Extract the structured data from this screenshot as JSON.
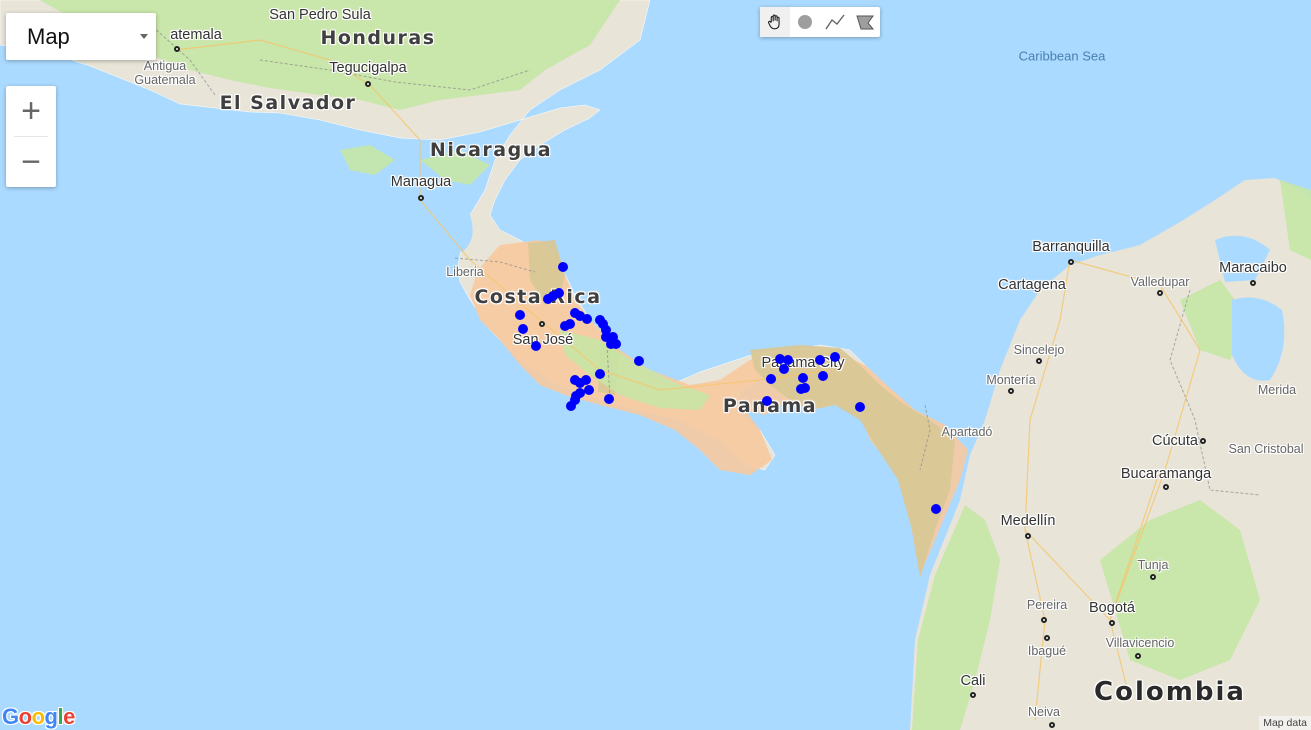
{
  "controls": {
    "map_type_label": "Map",
    "zoom_in_label": "+",
    "zoom_out_label": "−",
    "attribution": "Map data"
  },
  "draw_tools": [
    {
      "name": "hand-icon",
      "active": true
    },
    {
      "name": "circle-icon",
      "active": false
    },
    {
      "name": "polyline-icon",
      "active": false
    },
    {
      "name": "polygon-icon",
      "active": false
    }
  ],
  "logo": {
    "text": "Google",
    "colors": [
      "#4285F4",
      "#EA4335",
      "#FBBC05",
      "#4285F4",
      "#34A853",
      "#EA4335"
    ]
  },
  "colors": {
    "water": "#aadaff",
    "land": "#e8e4d8",
    "green": "#c5e6a6",
    "highlight_orange": "#f7c9a0",
    "highlight_olive": "#d9c796",
    "marker": "#0000ff"
  },
  "labels": {
    "country": [
      {
        "id": "honduras",
        "text": "Honduras"
      },
      {
        "id": "el-salvador",
        "text": "El Salvador"
      },
      {
        "id": "nicaragua",
        "text": "Nicaragua"
      },
      {
        "id": "costa-rica",
        "text": "Costa Rica"
      },
      {
        "id": "panama",
        "text": "Panama"
      }
    ],
    "big": [
      {
        "id": "colombia",
        "text": "Colombia"
      }
    ],
    "sea": [
      {
        "id": "caribbean",
        "text": "Caribbean Sea"
      }
    ],
    "city": [
      {
        "id": "san-pedro-sula",
        "text": "San Pedro Sula"
      },
      {
        "id": "guatemala",
        "text": "atemala"
      },
      {
        "id": "tegucigalpa",
        "text": "Tegucigalpa"
      },
      {
        "id": "managua",
        "text": "Managua"
      },
      {
        "id": "san-jose",
        "text": "San José"
      },
      {
        "id": "panama-city",
        "text": "Panama City"
      },
      {
        "id": "barranquilla",
        "text": "Barranquilla"
      },
      {
        "id": "maracaibo",
        "text": "Maracaibo"
      },
      {
        "id": "medellin",
        "text": "Medellín"
      },
      {
        "id": "bogota",
        "text": "Bogotá"
      },
      {
        "id": "cali",
        "text": "Cali"
      },
      {
        "id": "bucaramanga",
        "text": "Bucaramanga"
      },
      {
        "id": "cucuta",
        "text": "Cúcuta"
      },
      {
        "id": "cartagena",
        "text": "Cartagena"
      }
    ],
    "small": [
      {
        "id": "antigua",
        "text": "Antigua\nGuatemala"
      },
      {
        "id": "liberia",
        "text": "Liberia"
      },
      {
        "id": "apartado",
        "text": "Apartadó"
      },
      {
        "id": "valledupar",
        "text": "Valledupar"
      },
      {
        "id": "sincelejo",
        "text": "Sincelejo"
      },
      {
        "id": "monteria",
        "text": "Montería"
      },
      {
        "id": "merida",
        "text": "Merida"
      },
      {
        "id": "san-cristobal",
        "text": "San Cristobal"
      },
      {
        "id": "tunja",
        "text": "Tunja"
      },
      {
        "id": "pereira",
        "text": "Pereira"
      },
      {
        "id": "ibague",
        "text": "Ibagué"
      },
      {
        "id": "villavicencio",
        "text": "Villavicencio"
      },
      {
        "id": "neiva",
        "text": "Neiva"
      }
    ]
  }
}
